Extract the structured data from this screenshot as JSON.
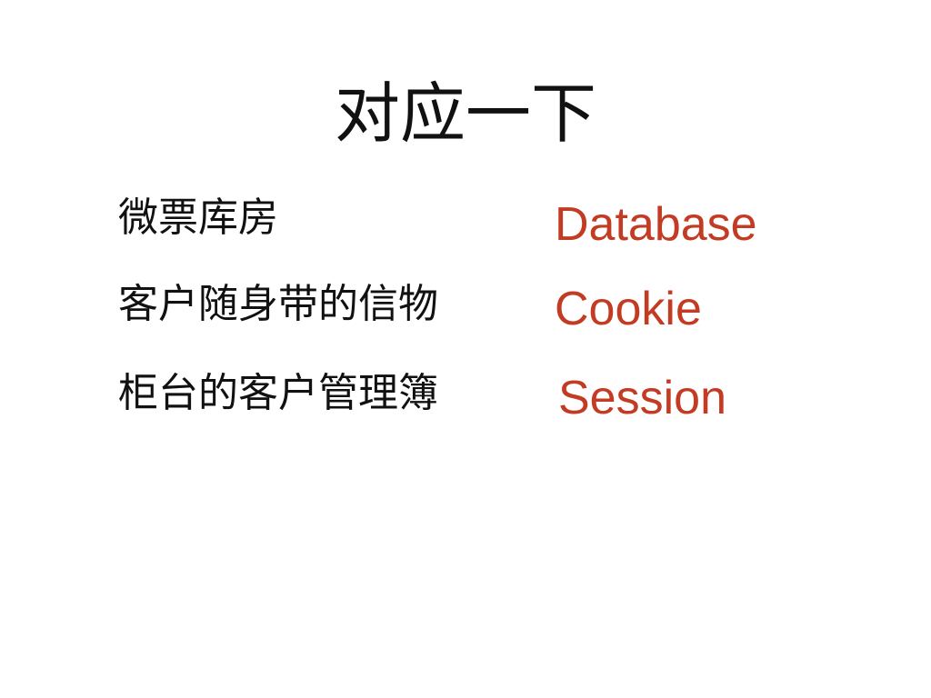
{
  "slide": {
    "title": "对应一下",
    "accent_color": "#c23b22",
    "rows": [
      {
        "term": "微票库房",
        "mapping": "Database"
      },
      {
        "term": "客户随身带的信物",
        "mapping": "Cookie"
      },
      {
        "term": "柜台的客户管理簿",
        "mapping": "Session"
      }
    ]
  }
}
